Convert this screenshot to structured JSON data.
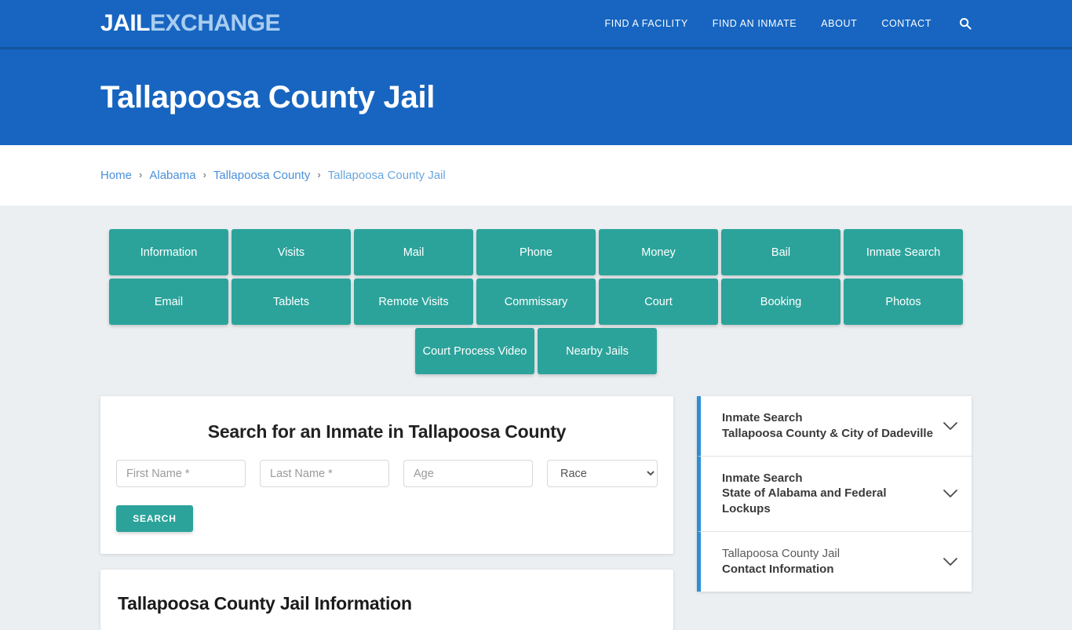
{
  "header": {
    "logo_part1": "JAIL",
    "logo_part2": "EXCHANGE",
    "nav": [
      {
        "label": "FIND A FACILITY",
        "name": "nav-find-a-facility"
      },
      {
        "label": "FIND AN INMATE",
        "name": "nav-find-an-inmate"
      },
      {
        "label": "ABOUT",
        "name": "nav-about"
      },
      {
        "label": "CONTACT",
        "name": "nav-contact"
      }
    ],
    "search_icon": "search-icon",
    "bg_color": "#1765c0"
  },
  "hero": {
    "title": "Tallapoosa County Jail"
  },
  "breadcrumb": {
    "separator": "›",
    "items": [
      {
        "label": "Home",
        "current": false
      },
      {
        "label": "Alabama",
        "current": false
      },
      {
        "label": "Tallapoosa County",
        "current": false
      },
      {
        "label": "Tallapoosa County Jail",
        "current": true
      }
    ]
  },
  "button_grid": {
    "accent_color": "#2ba39b",
    "row1": [
      {
        "label": "Information"
      },
      {
        "label": "Visits"
      },
      {
        "label": "Mail"
      },
      {
        "label": "Phone"
      },
      {
        "label": "Money"
      },
      {
        "label": "Bail"
      },
      {
        "label": "Inmate Search"
      }
    ],
    "row2": [
      {
        "label": "Email"
      },
      {
        "label": "Tablets"
      },
      {
        "label": "Remote Visits"
      },
      {
        "label": "Commissary"
      },
      {
        "label": "Court"
      },
      {
        "label": "Booking"
      },
      {
        "label": "Photos"
      }
    ],
    "row3": [
      {
        "label": "Court Process Video"
      },
      {
        "label": "Nearby Jails"
      }
    ]
  },
  "search_form": {
    "heading": "Search for an Inmate in Tallapoosa County",
    "first_name_placeholder": "First Name *",
    "last_name_placeholder": "Last Name *",
    "age_placeholder": "Age",
    "first_name_value": "",
    "last_name_value": "",
    "age_value": "",
    "race_selected": "Race",
    "race_options": [
      "Race"
    ],
    "submit_label": "SEARCH"
  },
  "info_section": {
    "heading": "Tallapoosa County Jail Information"
  },
  "sidebar": {
    "accent_color": "#2d8fd5",
    "chevron_icon": "chevron-down-icon",
    "panels": [
      {
        "line1": "Inmate Search",
        "line1_bold": true,
        "line2": "Tallapoosa County & City of Dadeville"
      },
      {
        "line1": "Inmate Search",
        "line1_bold": true,
        "line2": "State of Alabama and Federal Lockups"
      },
      {
        "line1": "Tallapoosa County Jail",
        "line1_bold": false,
        "line2": "Contact Information"
      }
    ]
  }
}
